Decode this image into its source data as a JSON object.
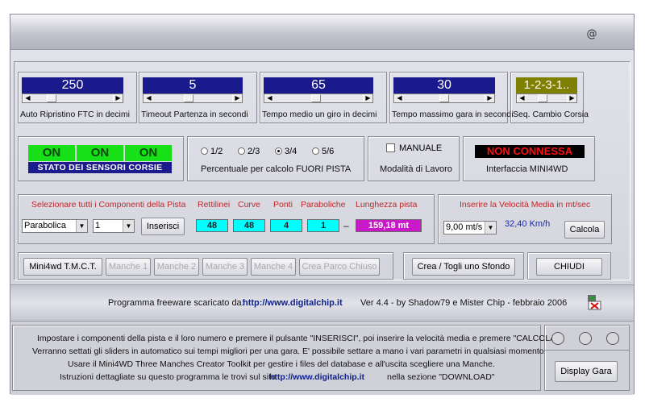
{
  "sliders": [
    {
      "value": "250",
      "caption": "Auto Ripristino FTC in decimi"
    },
    {
      "value": "5",
      "caption": "Timeout Partenza in secondi"
    },
    {
      "value": "65",
      "caption": "Tempo medio un giro in decimi"
    },
    {
      "value": "30",
      "caption": "Tempo massimo gara in secondi"
    }
  ],
  "seq": {
    "value": "1-2-3-1..",
    "caption": "Seq. Cambio Corsia",
    "color": "#808000"
  },
  "sensors": {
    "lanes": [
      "ON",
      "ON",
      "ON"
    ],
    "label": "STATO DEI SENSORI CORSIE"
  },
  "fuori_pista": {
    "options": [
      "1/2",
      "2/3",
      "3/4",
      "5/6"
    ],
    "selected": "3/4",
    "label": "Percentuale per calcolo FUORI PISTA"
  },
  "modalita": {
    "checkbox": "MANUALE",
    "label": "Modalità di Lavoro"
  },
  "interfaccia": {
    "status": "NON CONNESSA",
    "label": "Interfaccia MINI4WD"
  },
  "componenti": {
    "title": "Selezionare tutti i Componenti della Pista",
    "type_value": "Parabolica",
    "count_value": "1",
    "inserisci_button": "Inserisci",
    "headers": [
      "Rettilinei",
      "Curve",
      "Ponti",
      "Paraboliche",
      "Lunghezza pista"
    ],
    "values": [
      "48",
      "48",
      "4",
      "1"
    ],
    "separator": "–",
    "length": "159,18 mt"
  },
  "velocita": {
    "title": "Inserire la Velocità Media in mt/sec",
    "value": "9,00 mt/s",
    "kmh": "32,40 Km/h",
    "calcola_button": "Calcola"
  },
  "manches": [
    "Mini4wd T.M.C.T.",
    "Manche 1",
    "Manche 2",
    "Manche 3",
    "Manche 4",
    "Crea Parco Chiuso"
  ],
  "sfondo_button": "Crea / Togli uno Sfondo",
  "chiudi_button": "CHIUDI",
  "footer": {
    "prefix": "Programma freeware scaricato da:",
    "url": "http://www.digitalchip.it",
    "version": "Ver 4.4 - by Shadow79 e Mister Chip - febbraio 2006"
  },
  "instructions": [
    "Impostare i componenti della pista e il loro numero e premere il pulsante \"INSERISCI\", poi inserire la velocità media e premere \"CALCOLA\".",
    "Verranno settati gli sliders in automatico sui tempi migliori per una gara. E' possibile settare a mano i vari parametri in qualsiasi momento.",
    "Usare il Mini4WD Three Manches Creator Toolkit per gestire i files del database e all'uscita scegliere una Manche.",
    "Istruzioni dettagliate su questo programma le trovi sul sito:"
  ],
  "instr_url": "http://www.digitalchip.it",
  "instr_suffix": "nella sezione \"DOWNLOAD\"",
  "display_gara_button": "Display Gara"
}
